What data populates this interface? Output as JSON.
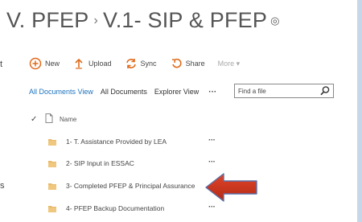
{
  "site": {
    "title_part1": "V. PFEP",
    "breadcrumb_sep": "›",
    "title_part2": "V.1- SIP & PFEP",
    "follow_icon": "◎"
  },
  "left_stubs": [
    "t",
    "s"
  ],
  "commands": [
    {
      "label": "New",
      "icon": "plus-circle-icon"
    },
    {
      "label": "Upload",
      "icon": "upload-arrow-icon"
    },
    {
      "label": "Sync",
      "icon": "sync-icon"
    },
    {
      "label": "Share",
      "icon": "share-icon"
    },
    {
      "label": "More ▾",
      "icon": ""
    }
  ],
  "views": [
    {
      "label": "All Documents View",
      "current": true
    },
    {
      "label": "All Documents",
      "current": false
    },
    {
      "label": "Explorer View",
      "current": false
    }
  ],
  "views_more": "···",
  "search": {
    "placeholder": "Find a file"
  },
  "list": {
    "header_check": "✓",
    "header_name": "Name",
    "rows": [
      {
        "name": "1- T. Assistance Provided by LEA",
        "dots": "···"
      },
      {
        "name": "2- SIP Input in ESSAC",
        "dots": "···"
      },
      {
        "name": "3- Completed PFEP & Principal Assurance",
        "dots": "···"
      },
      {
        "name": "4- PFEP Backup Documentation",
        "dots": "···"
      }
    ]
  },
  "colors": {
    "accent_orange": "#e06a1b",
    "link_blue": "#1e73be",
    "folder": "#e8b96a",
    "arrow_fill": "#c8321e",
    "arrow_stroke": "#5a6fa8"
  }
}
